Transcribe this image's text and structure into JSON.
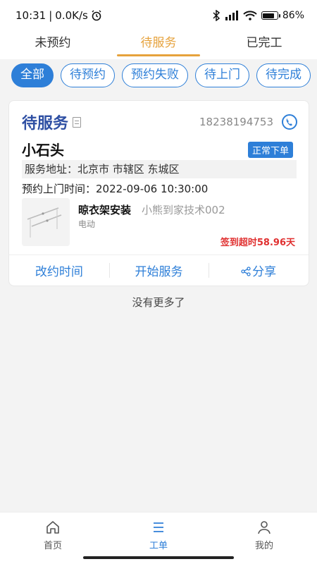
{
  "status_bar": {
    "time": "10:31",
    "network_speed": "0.0K/s",
    "battery": "86%",
    "battery_level": 0.86,
    "icons": [
      "alarm-icon",
      "bluetooth-icon",
      "signal-icon",
      "wifi-icon",
      "battery-icon"
    ]
  },
  "top_tabs": [
    {
      "label": "未预约",
      "active": false
    },
    {
      "label": "待服务",
      "active": true
    },
    {
      "label": "已完工",
      "active": false
    }
  ],
  "filters": [
    {
      "label": "全部",
      "active": true
    },
    {
      "label": "待预约",
      "active": false
    },
    {
      "label": "预约失败",
      "active": false
    },
    {
      "label": "待上门",
      "active": false
    },
    {
      "label": "待完成",
      "active": false
    }
  ],
  "order": {
    "status": "待服务",
    "phone": "18238194753",
    "customer": "小石头",
    "order_type_badge": "正常下单",
    "address_label": "服务地址：",
    "address": "北京市 市辖区 东城区",
    "appointment_label": "预约上门时间：",
    "appointment_time": "2022-09-06 10:30:00",
    "product_name": "晾衣架安装",
    "vendor": "小熊到家技术002",
    "product_sub": "电动",
    "overtime": "签到超时58.96天",
    "actions": {
      "reschedule": "改约时间",
      "start": "开始服务",
      "share": "分享"
    }
  },
  "list_end": "没有更多了",
  "bottom_nav": [
    {
      "label": "首页",
      "icon": "home-icon",
      "active": false
    },
    {
      "label": "工单",
      "icon": "list-icon",
      "active": true
    },
    {
      "label": "我的",
      "icon": "user-icon",
      "active": false
    }
  ],
  "colors": {
    "accent_orange": "#e6a23c",
    "primary_blue": "#2e7fd8",
    "status_title": "#2e4fa3",
    "alert_red": "#e03030"
  }
}
